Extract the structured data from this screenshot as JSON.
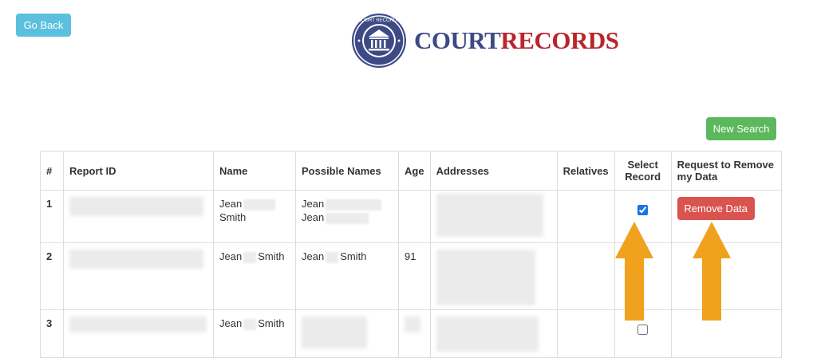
{
  "header": {
    "go_back_label": "Go Back",
    "new_search_label": "New Search",
    "logo": {
      "court": "COURT",
      "records": "RECORDS",
      "seal_text": "COURT RECORDS"
    }
  },
  "table": {
    "columns": [
      "#",
      "Report ID",
      "Name",
      "Possible Names",
      "Age",
      "Addresses",
      "Relatives",
      "Select Record",
      "Request to Remove my Data"
    ],
    "rows": [
      {
        "num": "1",
        "name_first": "Jean",
        "name_last": "Smith",
        "possible_1": "Jean",
        "possible_2": "Jean",
        "age": "",
        "selected": true,
        "remove_label": "Remove Data"
      },
      {
        "num": "2",
        "name_first": "Jean",
        "name_last": "Smith",
        "possible_first": "Jean",
        "possible_last": "Smith",
        "age": "91",
        "selected": false
      },
      {
        "num": "3",
        "name_first": "Jean",
        "name_last": "Smith",
        "age": "",
        "selected": false
      }
    ]
  },
  "colors": {
    "info": "#5bc0de",
    "success": "#5cb85c",
    "danger": "#d9534f",
    "arrow": "#f0a21f",
    "logo_blue": "#3d4a86",
    "logo_red": "#b8252c"
  }
}
